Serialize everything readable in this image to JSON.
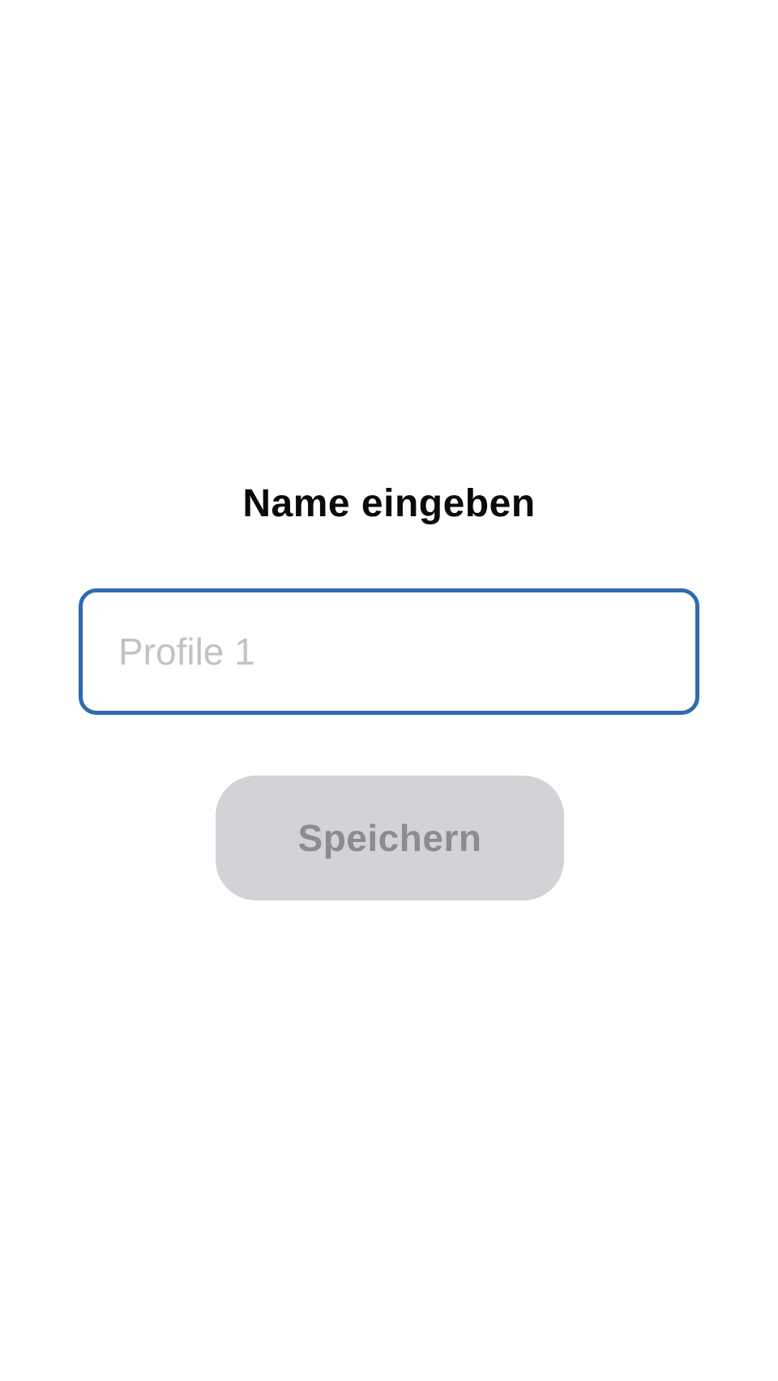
{
  "dialog": {
    "title": "Name eingeben",
    "name_field": {
      "value": "",
      "placeholder": "Profile 1"
    },
    "save_label": "Speichern"
  },
  "colors": {
    "field_border_focus": "#2f6aae",
    "button_disabled_bg": "#d2d2d7",
    "button_disabled_text": "#8b8b90",
    "placeholder_text": "#c2c2c6",
    "title_text": "#0a0a0a"
  }
}
